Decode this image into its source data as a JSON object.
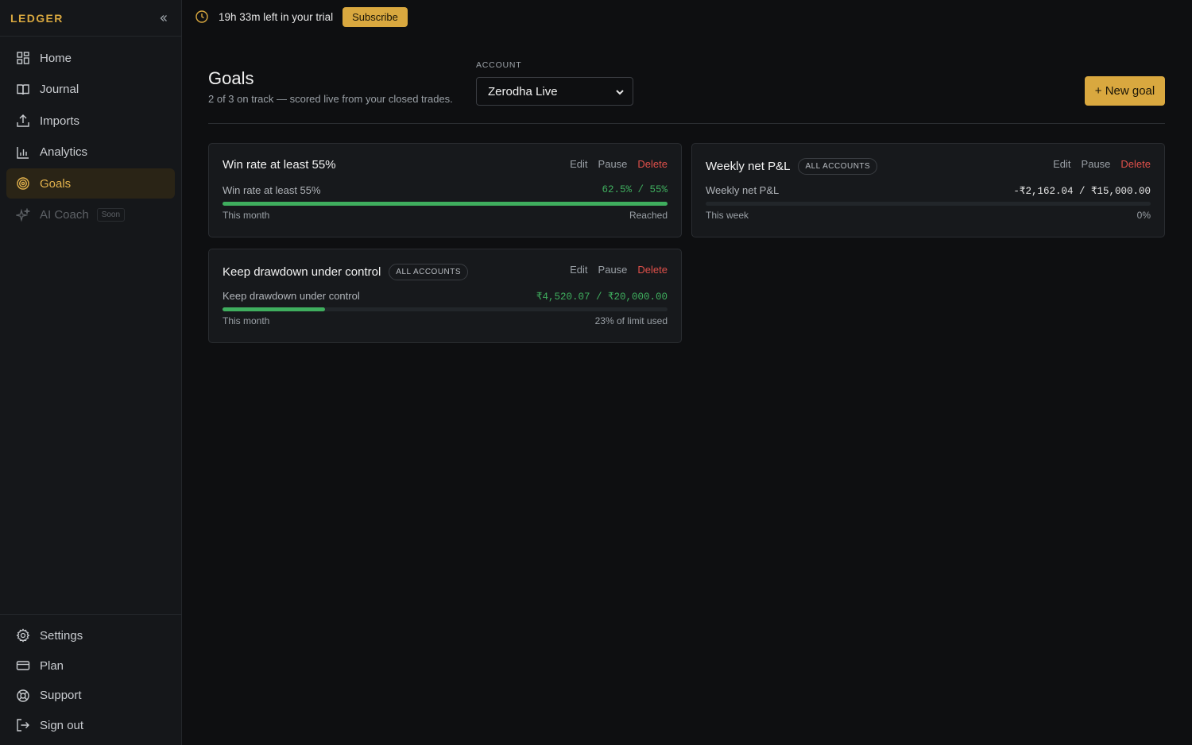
{
  "sidebar": {
    "brand": "LEDGER",
    "items": [
      {
        "label": "Home",
        "icon": "grid-icon"
      },
      {
        "label": "Journal",
        "icon": "book-icon"
      },
      {
        "label": "Imports",
        "icon": "upload-icon"
      },
      {
        "label": "Analytics",
        "icon": "bar-chart-icon"
      },
      {
        "label": "Goals",
        "icon": "target-icon",
        "active": true
      },
      {
        "label": "AI Coach",
        "icon": "sparkle-icon",
        "badge": "Soon",
        "disabled": true
      }
    ],
    "bottom_items": [
      {
        "label": "Settings",
        "icon": "gear-icon"
      },
      {
        "label": "Plan",
        "icon": "credit-card-icon"
      },
      {
        "label": "Support",
        "icon": "lifebuoy-icon"
      },
      {
        "label": "Sign out",
        "icon": "sign-out-icon"
      }
    ]
  },
  "trial": {
    "text": "19h 33m left in your trial",
    "subscribe_label": "Subscribe"
  },
  "page": {
    "title": "Goals",
    "subtitle": "2 of 3 on track — scored live from your closed trades.",
    "account_label": "ACCOUNT",
    "account_value": "Zerodha Live",
    "new_goal_label": "+ New goal"
  },
  "actions": {
    "edit": "Edit",
    "pause": "Pause",
    "delete": "Delete"
  },
  "goals": [
    {
      "title": "Win rate at least 55%",
      "metric_label": "Win rate at least 55%",
      "value": "62.5% / 55%",
      "progress": 1.0,
      "period": "This month",
      "status": "Reached",
      "value_color": "#3fae5e"
    },
    {
      "title": "Weekly net P&L",
      "pill": "ALL ACCOUNTS",
      "metric_label": "Weekly net P&L",
      "value": "-₹2,162.04 / ₹15,000.00",
      "progress": 0.0,
      "period": "This week",
      "status": "0%",
      "value_color": "#e6e6e6"
    },
    {
      "title": "Keep drawdown under control",
      "pill": "ALL ACCOUNTS",
      "metric_label": "Keep drawdown under control",
      "value": "₹4,520.07 / ₹20,000.00",
      "progress": 0.23,
      "period": "This month",
      "status": "23% of limit used",
      "value_color": "#3fae5e"
    }
  ],
  "colors": {
    "accent": "#d9a83f",
    "success": "#3fae5e",
    "danger": "#e0504a"
  }
}
